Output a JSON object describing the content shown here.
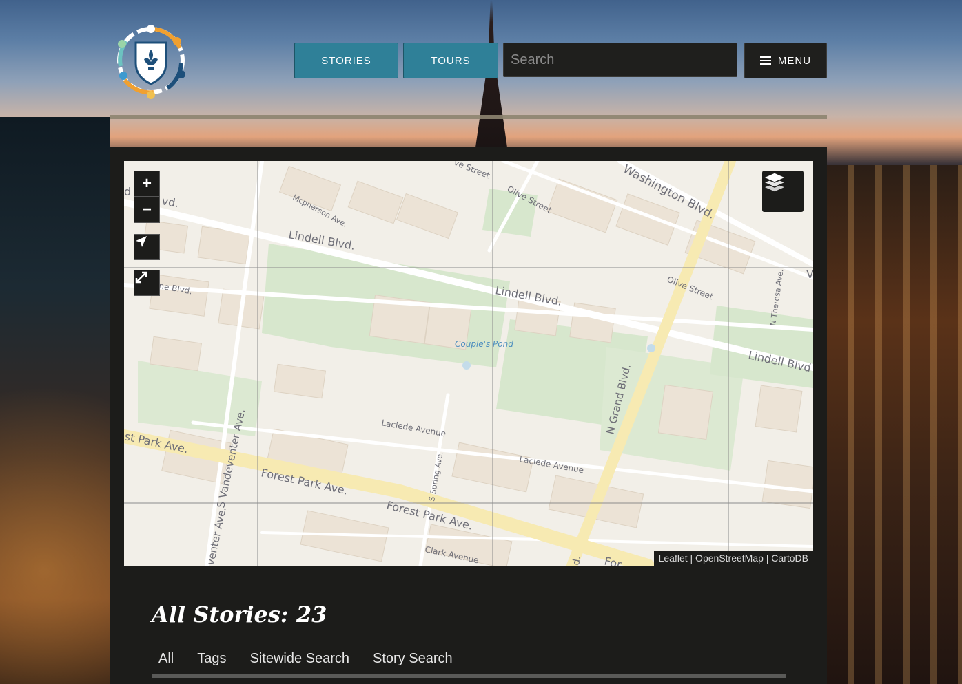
{
  "header": {
    "nav": [
      {
        "label": "STORIES"
      },
      {
        "label": "TOURS"
      }
    ],
    "search_placeholder": "Search",
    "menu_label": "MENU"
  },
  "map": {
    "zoom_in": "+",
    "zoom_out": "−",
    "attribution": "Leaflet | OpenStreetMap | CartoDB",
    "labels": {
      "washington": "Washington Blvd.",
      "olive1": "Olive Street",
      "olive2": "Olive Street",
      "olive_top": "ve Street",
      "mcpherson": "Mcpherson Ave.",
      "lindell1": "Lindell Blvd.",
      "lindell2": "Lindell Blvd.",
      "lindell3": "Lindell Blvd",
      "lindell_left": "vd.",
      "lindell_left_prefix": "d",
      "ne_blvd": "ne Blvd.",
      "pond": "Couple's Pond",
      "grand": "N Grand Blvd.",
      "theresa": "N Theresa Ave.",
      "v_right": "V",
      "laclede1": "Laclede Avenue",
      "laclede2": "Laclede Avenue",
      "spring": "S Spring Ave.",
      "vandeventer": "S Vandeventer Ave.",
      "vandeventer2": "venter Ave.",
      "forest_left": "st Park Ave.",
      "forest1": "Forest Park Ave.",
      "forest2": "Forest Park Ave.",
      "forest3": "For",
      "clark": "Clark Avenue",
      "d_bottom": "d."
    }
  },
  "content": {
    "title": "All Stories: 23",
    "tabs": [
      {
        "label": "All"
      },
      {
        "label": "Tags"
      },
      {
        "label": "Sitewide Search"
      },
      {
        "label": "Story Search"
      }
    ]
  }
}
